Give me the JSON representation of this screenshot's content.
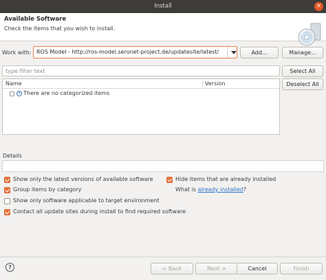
{
  "window": {
    "title": "Install",
    "close_glyph": "×"
  },
  "header": {
    "title": "Available Software",
    "subtitle": "Check the items that you wish to install."
  },
  "work_with": {
    "label": "Work with:",
    "value": "ROS Model - http://ros-model.seronet-project.de/updatesite/latest/",
    "add_label": "Add...",
    "manage_label": "Manage..."
  },
  "filter": {
    "placeholder": "type filter text",
    "select_all_label": "Select All",
    "deselect_all_label": "Deselect All"
  },
  "tree": {
    "columns": [
      "Name",
      "Version"
    ],
    "rows": [
      {
        "label": "There are no categorized items"
      }
    ]
  },
  "details": {
    "label": "Details"
  },
  "options": {
    "latest_versions": {
      "label": "Show only the latest versions of available software",
      "checked": true
    },
    "hide_installed": {
      "label": "Hide items that are already installed",
      "checked": true
    },
    "group_by_category": {
      "label": "Group items by category",
      "checked": true
    },
    "what_is": {
      "prefix": "What is ",
      "link": "already installed",
      "suffix": "?"
    },
    "target_env": {
      "label": "Show only software applicable to target environment",
      "checked": false
    },
    "contact_sites": {
      "label": "Contact all update sites during install to find required software",
      "checked": true
    }
  },
  "buttons": {
    "back": "< Back",
    "next": "Next >",
    "cancel": "Cancel",
    "finish": "Finish",
    "help_glyph": "?"
  },
  "colors": {
    "accent": "#e8743b",
    "link": "#2a76c6",
    "titlebar": "#3d3c38"
  }
}
